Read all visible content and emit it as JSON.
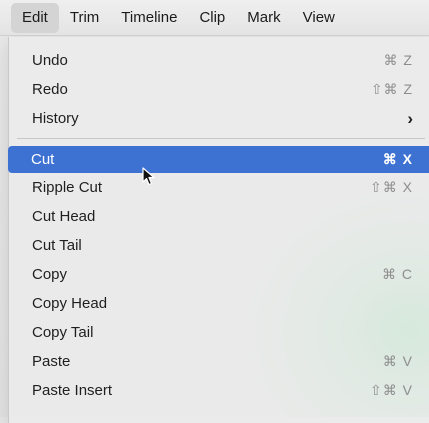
{
  "menubar": {
    "items": [
      {
        "label": "Edit"
      },
      {
        "label": "Trim"
      },
      {
        "label": "Timeline"
      },
      {
        "label": "Clip"
      },
      {
        "label": "Mark"
      },
      {
        "label": "View"
      }
    ]
  },
  "menu": {
    "group1": [
      {
        "label": "Undo",
        "shortcut": "⌘ Z"
      },
      {
        "label": "Redo",
        "shortcut": "⇧⌘ Z"
      },
      {
        "label": "History",
        "shortcut": "›"
      }
    ],
    "group2": [
      {
        "label": "Cut",
        "shortcut": "⌘ X"
      },
      {
        "label": "Ripple Cut",
        "shortcut": "⇧⌘ X"
      },
      {
        "label": "Cut Head",
        "shortcut": ""
      },
      {
        "label": "Cut Tail",
        "shortcut": ""
      },
      {
        "label": "Copy",
        "shortcut": "⌘ C"
      },
      {
        "label": "Copy Head",
        "shortcut": ""
      },
      {
        "label": "Copy Tail",
        "shortcut": ""
      },
      {
        "label": "Paste",
        "shortcut": "⌘ V"
      },
      {
        "label": "Paste Insert",
        "shortcut": "⇧⌘ V"
      }
    ]
  },
  "colors": {
    "highlight": "#3d72d3",
    "shortcut_text": "#8d8d8d",
    "background_accent": "#8fe0a8"
  }
}
